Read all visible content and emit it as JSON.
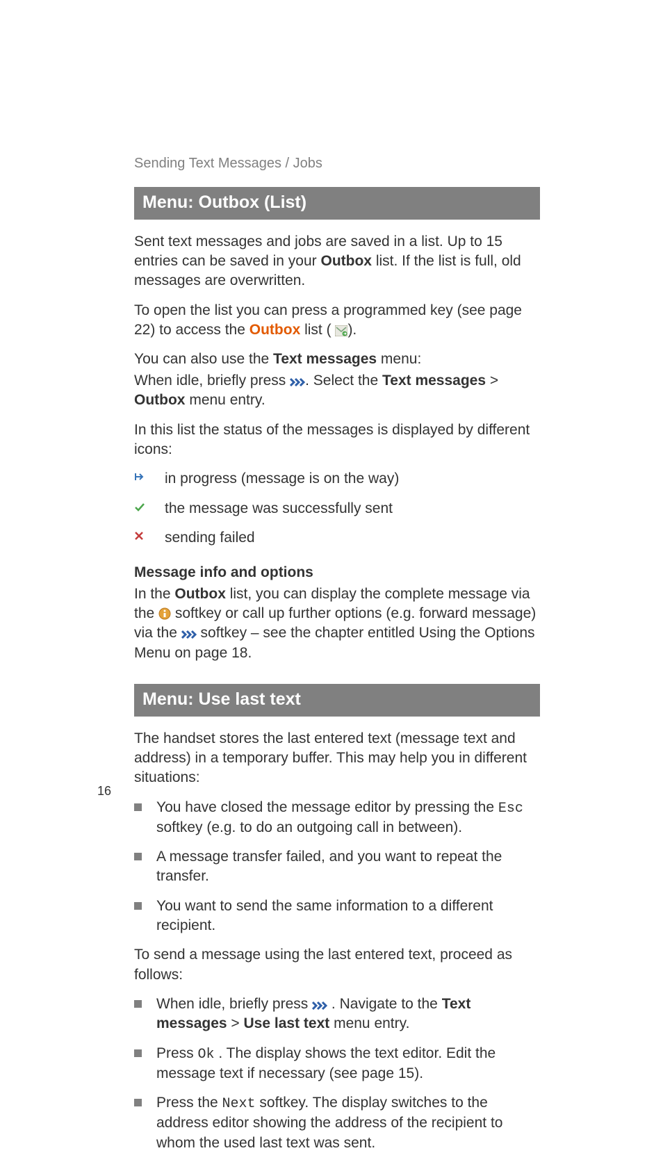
{
  "header": {
    "text": "Sending Text Messages / Jobs"
  },
  "section1": {
    "title": "Menu: Outbox (List)",
    "p1a": "Sent text messages and jobs are saved in a list. Up to 15 entries can be saved in your ",
    "p1b": "Outbox",
    "p1c": " list. If the list is full, old messages are overwritten.",
    "p2a": "To open the list you can press a programmed key (see page 22) to access the ",
    "p2b": "Outbox",
    "p2c": " list ( ",
    "p2d": ").",
    "p3a": "You can also use the ",
    "p3b": "Text messages",
    "p3c": " menu:",
    "p4a": "When idle, briefly press ",
    "p4b": ". Select the ",
    "p4c": "Text messages",
    "p4d": " > ",
    "p4e": "Outbox",
    "p4f": " menu entry.",
    "p5": "In this list the status of the messages is displayed by different icons:",
    "icons": {
      "i1": "in progress (message is on the way)",
      "i2": "the message was successfully sent",
      "i3": "sending failed"
    },
    "sub": "Message info and options",
    "p6a": "In the ",
    "p6b": "Outbox",
    "p6c": " list, you can display the complete message via the ",
    "p6d": " softkey or call up further options (e.g. forward message) via the ",
    "p6e": " softkey – see the chapter entitled Using the Options Menu on page 18."
  },
  "section2": {
    "title": "Menu: Use last text",
    "p1": "The handset stores the last entered text (message text and address) in a temporary buffer. This may help you in different situations:",
    "b1a": "You have closed the message editor by pressing the ",
    "b1b": "Esc",
    "b1c": " softkey (e.g. to do an outgoing call in between).",
    "b2": "A message transfer failed, and you want to repeat the transfer.",
    "b3": "You want to send the same information to a different recipient.",
    "p2": "To send a message using the last entered text, proceed as follows:",
    "b4a": "When idle, briefly press ",
    "b4b": " . Navigate to the ",
    "b4c": "Text messages",
    "b4d": " > ",
    "b4e": "Use last text",
    "b4f": " menu entry.",
    "b5a": "Press ",
    "b5b": "Ok",
    "b5c": " . The display shows the text editor. Edit the message text if necessary (see page 15).",
    "b6a": "Press the ",
    "b6b": "Next",
    "b6c": " softkey. The display switches to the address editor showing the address of the recipient to whom the used last text was sent."
  },
  "pagenum": "16"
}
